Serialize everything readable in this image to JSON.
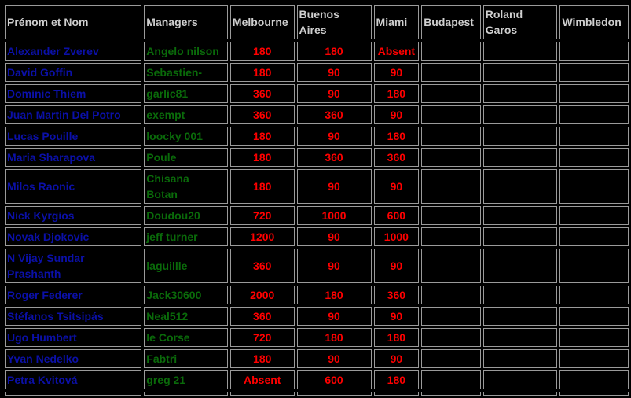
{
  "headers": [
    "Prénom et Nom",
    "Managers",
    "Melbourne",
    "Buenos Aires",
    "Miami",
    "Budapest",
    "Roland Garos",
    "Wimbledon"
  ],
  "header_lines": {
    "buenos": [
      "Buenos",
      "Aires"
    ],
    "roland": [
      "Roland",
      "Garos"
    ]
  },
  "rows": [
    {
      "name": "Alexander Zverev",
      "manager": "Angelo nilson",
      "melbourne": "180",
      "buenos": "180",
      "miami": "Absent"
    },
    {
      "name": "David Goffin",
      "manager": "Sebastien-",
      "melbourne": "180",
      "buenos": "90",
      "miami": "90"
    },
    {
      "name": "Dominic Thiem",
      "manager": "garlic81",
      "melbourne": "360",
      "buenos": "90",
      "miami": "180"
    },
    {
      "name": "Juan Martin Del Potro",
      "manager": "exempt",
      "melbourne": "360",
      "buenos": "360",
      "miami": "90"
    },
    {
      "name": "Lucas Pouille",
      "manager": "loocky 001",
      "melbourne": "180",
      "buenos": "90",
      "miami": "180"
    },
    {
      "name": "Maria Sharapova",
      "manager": "Poule",
      "melbourne": "180",
      "buenos": "360",
      "miami": "360"
    },
    {
      "name": "Milos Raonic",
      "manager": "Chisana Botan",
      "manager_lines": [
        "Chisana",
        "Botan"
      ],
      "melbourne": "180",
      "buenos": "90",
      "miami": "90"
    },
    {
      "name": "Nick Kyrgios",
      "manager": "Doudou20",
      "melbourne": "720",
      "buenos": "1000",
      "miami": "600"
    },
    {
      "name": "Novak Djokovic",
      "manager": "jeff turner",
      "melbourne": "1200",
      "buenos": "90",
      "miami": "1000"
    },
    {
      "name": "N Vijay Sundar Prashanth",
      "name_lines": [
        "N Vijay Sundar",
        "Prashanth"
      ],
      "manager": "laguillle",
      "melbourne": "360",
      "buenos": "90",
      "miami": "90"
    },
    {
      "name": "Roger Federer",
      "manager": "Jack30600",
      "melbourne": "2000",
      "buenos": "180",
      "miami": "360"
    },
    {
      "name": "Stéfanos Tsitsipás",
      "manager": "Neal512",
      "melbourne": "360",
      "buenos": "90",
      "miami": "90"
    },
    {
      "name": "Ugo Humbert",
      "manager": "le Corse",
      "melbourne": "720",
      "buenos": "180",
      "miami": "180"
    },
    {
      "name": "Yvan Nedelko",
      "manager": "Fabtri",
      "melbourne": "180",
      "buenos": "90",
      "miami": "90"
    },
    {
      "name": "Petra Kvitová",
      "manager": "greg 21",
      "melbourne": "Absent",
      "buenos": "600",
      "miami": "180"
    }
  ]
}
